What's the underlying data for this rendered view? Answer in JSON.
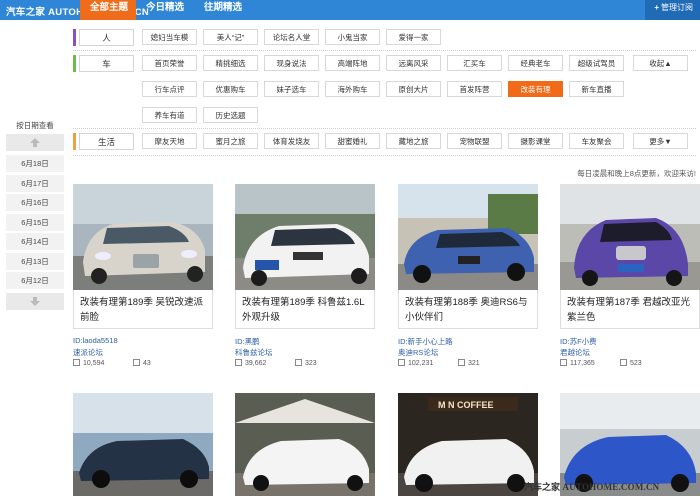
{
  "header": {
    "logo": "汽车之家 AUTOHOME.COM.CN",
    "tabs": [
      {
        "label": "全部主题",
        "active": true
      },
      {
        "label": "今日精选",
        "active": false
      },
      {
        "label": "往期精选",
        "active": false
      }
    ],
    "manage": "管理订阅"
  },
  "filters": {
    "rows": [
      {
        "category": "人",
        "color": "#8a4fc7",
        "tags": [
          "媳妇当车模",
          "美人“记”",
          "论坛名人堂",
          "小鬼当家",
          "爱得一家"
        ]
      },
      {
        "category": "车",
        "color": "#6bbd49",
        "tags": [
          "首页荣誉",
          "精挑细选",
          "现身说法",
          "高端阵地",
          "远离风采",
          "汇买车",
          "经典老车",
          "超级试驾员",
          "收起▲"
        ],
        "tags2": [
          "行车点评",
          "优惠购车",
          "妹子选车",
          "海外购车",
          "原创大片",
          "首发阵营",
          "改装有理",
          "新车直播"
        ],
        "tags3": [
          "养车有道",
          "历史选题"
        ]
      },
      {
        "category": "生活",
        "color": "#f0a044",
        "tags": [
          "摩友天地",
          "蜜月之旅",
          "体育发烧友",
          "甜蜜婚礼",
          "藏地之旅",
          "宠物联盟",
          "摄影课堂",
          "车友聚会",
          "更多▼"
        ]
      }
    ],
    "active_tag": "改装有理"
  },
  "datepanel": {
    "title": "按日期查看",
    "dates": [
      "6月18日",
      "6月17日",
      "6月16日",
      "6月15日",
      "6月14日",
      "6月13日",
      "6月12日"
    ]
  },
  "notice": "每日凌晨和晚上8点更新，欢迎来访!",
  "cards": [
    {
      "title": "改装有理第189季 吴锐改速派前脸",
      "id": "ID:laoda5518",
      "forum": "速派论坛",
      "views": "10,594",
      "replies": "43"
    },
    {
      "title": "改装有理第189季 科鲁兹1.6L外观升级",
      "id": "ID:黑鹏",
      "forum": "科鲁兹论坛",
      "views": "39,662",
      "replies": "323"
    },
    {
      "title": "改装有理第188季 奥迪RS6与小伙伴们",
      "id": "ID:新手小心上路",
      "forum": "奥迪RS论坛",
      "views": "102,231",
      "replies": "321"
    },
    {
      "title": "改装有理第187季 君越改亚光紫兰色",
      "id": "ID:苏F小费",
      "forum": "君越论坛",
      "views": "117,365",
      "replies": "523"
    }
  ],
  "watermark": {
    "cn": "汽车之家",
    "en": "AUTOHOME.COM.CN"
  },
  "colors": {
    "header_blue": "#2f86d6",
    "active_orange": "#ef6d1a",
    "link_blue": "#2b5da8"
  }
}
